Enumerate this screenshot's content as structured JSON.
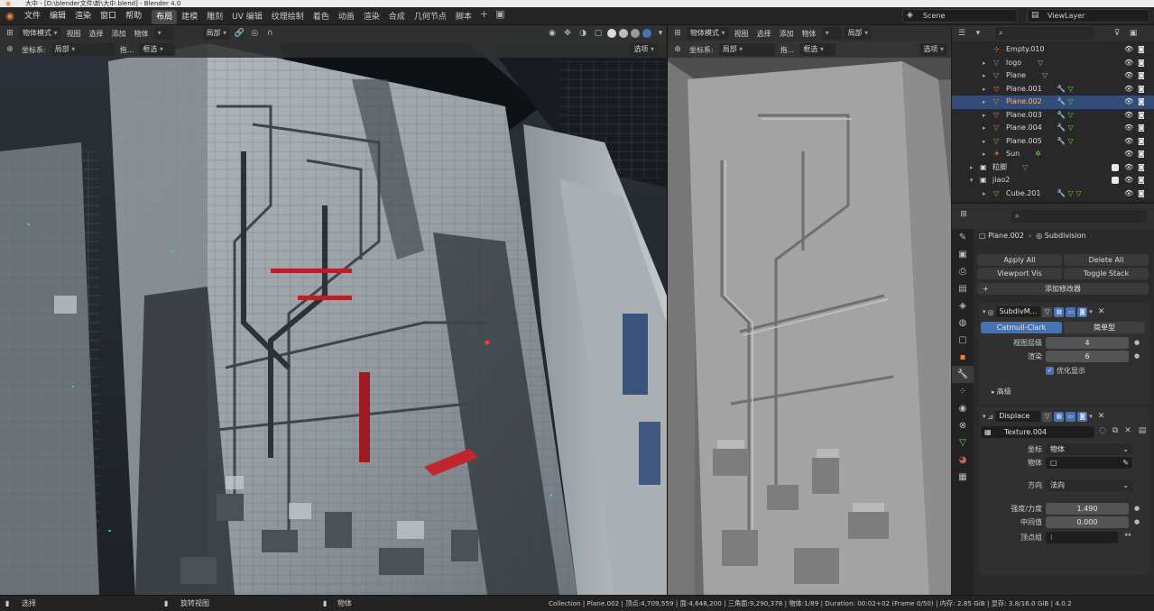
{
  "window": {
    "title": "大中 - [D:\\blender文件\\新\\大中.blend] - Blender 4.0"
  },
  "menubar": {
    "menus": [
      "文件",
      "编辑",
      "渲染",
      "窗口",
      "帮助"
    ],
    "workspaces": [
      "布局",
      "建模",
      "雕刻",
      "UV 编辑",
      "纹理绘制",
      "着色",
      "动画",
      "渲染",
      "合成",
      "几何节点",
      "脚本"
    ],
    "active_workspace": "布局",
    "scene": "Scene",
    "view_layer": "ViewLayer"
  },
  "viewport_left": {
    "mode": "物体模式",
    "menus": [
      "视图",
      "选择",
      "添加",
      "物体"
    ],
    "pivot": "局部",
    "orientation_label": "坐标系:",
    "orientation": "局部",
    "drag_label": "拖...",
    "drag": "框选",
    "options": "选项"
  },
  "viewport_right": {
    "mode": "物体模式",
    "menus": [
      "视图",
      "选择",
      "添加",
      "物体"
    ],
    "pivot": "局部",
    "orientation_label": "坐标系:",
    "orientation": "局部",
    "drag_label": "拖...",
    "drag": "框选",
    "options": "选项"
  },
  "outliner": {
    "items": [
      {
        "name": "Empty.010",
        "type": "empty",
        "selected": false
      },
      {
        "name": "logo",
        "type": "mesh",
        "selected": false
      },
      {
        "name": "Plane",
        "type": "mesh",
        "selected": false
      },
      {
        "name": "Plane.001",
        "type": "mesh",
        "selected": false
      },
      {
        "name": "Plane.002",
        "type": "mesh",
        "selected": true
      },
      {
        "name": "Plane.003",
        "type": "mesh",
        "selected": false
      },
      {
        "name": "Plane.004",
        "type": "mesh",
        "selected": false
      },
      {
        "name": "Plane.005",
        "type": "mesh",
        "selected": false
      },
      {
        "name": "Sun",
        "type": "light",
        "selected": false
      },
      {
        "name": "粒脚",
        "type": "collection",
        "selected": false
      },
      {
        "name": "jiao2",
        "type": "collection",
        "selected": false
      },
      {
        "name": "Cube.201",
        "type": "mesh",
        "selected": false
      }
    ]
  },
  "properties": {
    "object_name": "Plane.002",
    "modifier_crumb": "Subdivision",
    "apply_all": "Apply All",
    "delete_all": "Delete All",
    "viewport_vis": "Viewport Vis",
    "toggle_stack": "Toggle Stack",
    "add_modifier": "添加修改器",
    "subdiv": {
      "name": "SubdivM...",
      "algorithm_active": "Catmull-Clark",
      "algorithm_other": "简单型",
      "levels_viewport_label": "视图层级",
      "levels_viewport": "4",
      "render_label": "渲染",
      "render": "6",
      "optimal_label": "优化显示",
      "advanced_label": "高级"
    },
    "displace": {
      "name": "Displace",
      "texture": "Texture.004",
      "coords_label": "坐标",
      "coords": "物体",
      "object_label": "物体",
      "direction_label": "方向",
      "direction": "法向",
      "strength_label": "强度/力度",
      "strength": "1.490",
      "midlevel_label": "中间值",
      "midlevel": "0.000",
      "vgroup_label": "顶点组"
    }
  },
  "statusbar": {
    "select": "选择",
    "rotate": "旋转视图",
    "object": "物体",
    "stats": "Collection | Plane.002 | 顶点:4,709,559 | 面:4,648,200 | 三角面:9,290,378 | 物体:1/89 | Duration: 00:02+02 (Frame 0/50) | 内存: 2.85 GiB | 显存: 3.8/16.0 GiB | 4.0.2"
  },
  "colors": {
    "accent": "#4772b3",
    "selected_row": "#334c78",
    "orange": "#e8843a",
    "green": "#6fd35c"
  }
}
